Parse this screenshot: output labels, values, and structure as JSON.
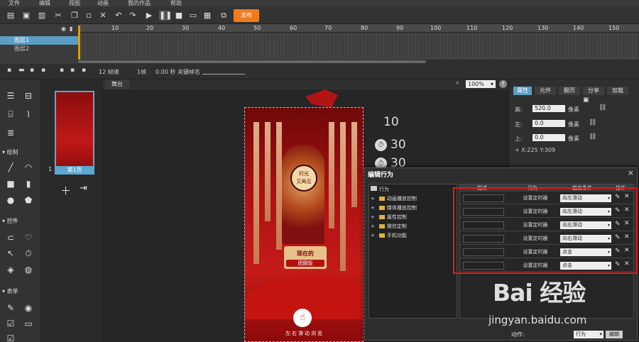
{
  "menu": [
    "文件",
    "编辑",
    "视图",
    "动画",
    "我的作品",
    "帮助"
  ],
  "toolbar": {
    "publish_label": "发布",
    "icons": [
      "new-icon",
      "open-icon",
      "save-icon",
      "cut-icon",
      "copy-icon",
      "paste-icon",
      "delete-icon",
      "undo-icon",
      "redo-icon",
      "play-icon",
      "pause-icon",
      "stop-icon",
      "preview-icon",
      "qrcode-icon",
      "share-icon"
    ]
  },
  "timeline": {
    "ruler": [
      "10",
      "20",
      "30",
      "40",
      "50",
      "60",
      "70",
      "80",
      "90",
      "100",
      "110",
      "120",
      "130",
      "140",
      "150"
    ],
    "layers": [
      "图层1",
      "图层2"
    ]
  },
  "subbar": {
    "fps": "12 帧速",
    "frame": "1帧",
    "time": "0.00 秒",
    "keyframe_label": "关键帧名"
  },
  "tool_sections": [
    "绘制",
    "控件",
    "表单"
  ],
  "pages": {
    "number": "1",
    "label": "第1页"
  },
  "stage": {
    "tab": "舞台",
    "zoom": "100%",
    "help": "?",
    "timer_values": [
      "10",
      "30",
      "30"
    ],
    "content": {
      "clock_line1": "时光",
      "clock_line2": "又再见",
      "banner_line1": "现在的",
      "banner_line2": "团圆饭",
      "swipe_text": "左右滑动浏览"
    }
  },
  "props": {
    "tabs": [
      "属性",
      "元件",
      "翻页",
      "分享",
      "加载"
    ],
    "height_label": "高:",
    "height_value": "520.0",
    "left_label": "左:",
    "left_value": "0.0",
    "top_label": "上:",
    "top_value": "0.0",
    "unit": "像素",
    "coords": "X:225    Y:309",
    "action_label": "动作:",
    "action_value": "行为",
    "edit_label": "编辑"
  },
  "dialog": {
    "title": "编辑行为",
    "close": "×",
    "tree_root": "行为",
    "tree_items": [
      "动画播放控制",
      "媒体播放控制",
      "属性控制",
      "微信定制",
      "手机功能"
    ],
    "columns": [
      "描述",
      "行为",
      "触发条件",
      "操作"
    ],
    "rows": [
      {
        "action": "设置定时器",
        "trigger": "向左滑动"
      },
      {
        "action": "设置定时器",
        "trigger": "向左滑动"
      },
      {
        "action": "设置定时器",
        "trigger": "向右滑动"
      },
      {
        "action": "设置定时器",
        "trigger": "向右滑动"
      },
      {
        "action": "设置定时器",
        "trigger": "点击"
      },
      {
        "action": "设置定时器",
        "trigger": "点击"
      }
    ]
  },
  "watermark": {
    "logo": "Bai 经验",
    "url": "jingyan.baidu.com"
  },
  "colors": {
    "accent": "#5b9ec4",
    "publish": "#f07c1e",
    "highlight": "#e01b1b",
    "canvas_red": "#c41a18"
  }
}
